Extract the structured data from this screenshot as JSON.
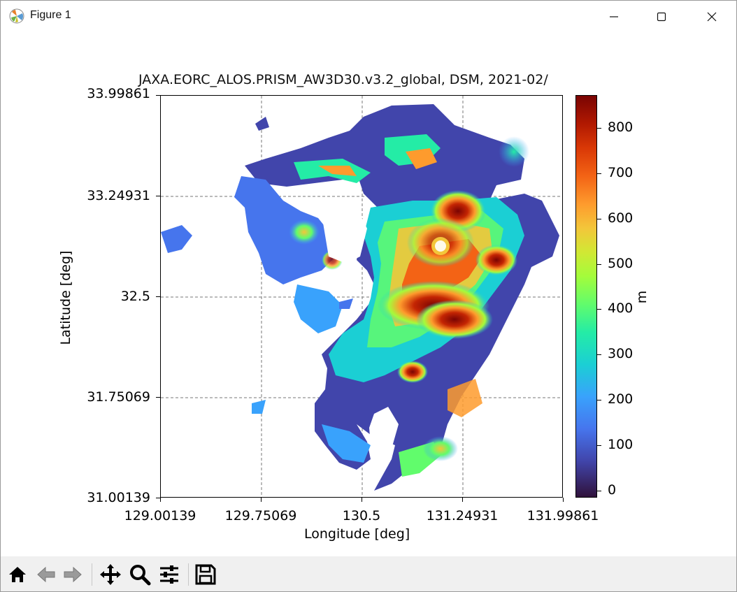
{
  "window": {
    "title": "Figure 1",
    "controls": [
      "minimize-icon",
      "maximize-icon",
      "close-icon"
    ]
  },
  "figure": {
    "title": "JAXA.EORC_ALOS.PRISM_AW3D30.v3.2_global, DSM, 2021-02/",
    "xlabel": "Longitude [deg]",
    "ylabel": "Latitude [deg]",
    "colorbar_label": "m",
    "colorbar_ticks": [
      "0",
      "100",
      "200",
      "300",
      "400",
      "500",
      "600",
      "700",
      "800"
    ]
  },
  "chart_data": {
    "type": "heatmap",
    "title": "JAXA.EORC_ALOS.PRISM_AW3D30.v3.2_global, DSM, 2021-02/",
    "xlabel": "Longitude [deg]",
    "ylabel": "Latitude [deg]",
    "xticks": [
      "129.00139",
      "129.75069",
      "130.5",
      "131.24931",
      "131.99861"
    ],
    "yticks": [
      "31.00139",
      "31.75069",
      "32.5",
      "33.24931",
      "33.99861"
    ],
    "xlim": [
      129.00139,
      131.99861
    ],
    "ylim": [
      31.00139,
      33.99861
    ],
    "grid": true,
    "colormap": "turbo",
    "colorbar": {
      "label": "m",
      "range": [
        -20,
        870
      ],
      "ticks": [
        0,
        100,
        200,
        300,
        400,
        500,
        600,
        700,
        800
      ]
    }
  },
  "toolbar": {
    "buttons": [
      "home-icon",
      "back-icon",
      "forward-icon",
      "pan-icon",
      "zoom-icon",
      "configure-subplots-icon",
      "save-icon"
    ]
  }
}
